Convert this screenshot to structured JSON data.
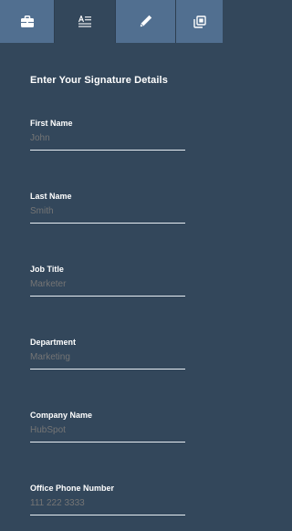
{
  "tabs": [
    {
      "icon": "briefcase-icon",
      "active": false
    },
    {
      "icon": "text-format-icon",
      "active": true
    },
    {
      "icon": "pencil-icon",
      "active": false
    },
    {
      "icon": "copy-icon",
      "active": false
    }
  ],
  "panel": {
    "title": "Enter Your Signature Details"
  },
  "fields": {
    "first_name": {
      "label": "First Name",
      "value": "John"
    },
    "last_name": {
      "label": "Last Name",
      "value": "Smith"
    },
    "job_title": {
      "label": "Job Title",
      "value": "Marketer"
    },
    "department": {
      "label": "Department",
      "value": "Marketing"
    },
    "company_name": {
      "label": "Company Name",
      "value": "HubSpot"
    },
    "office_phone": {
      "label": "Office Phone Number",
      "value": "111 222 3333"
    }
  },
  "colors": {
    "panel_bg": "#33475b",
    "tab_bg": "#516f90",
    "label": "#ffffff",
    "value": "#a7b3c0",
    "underline": "#e8eef3"
  }
}
